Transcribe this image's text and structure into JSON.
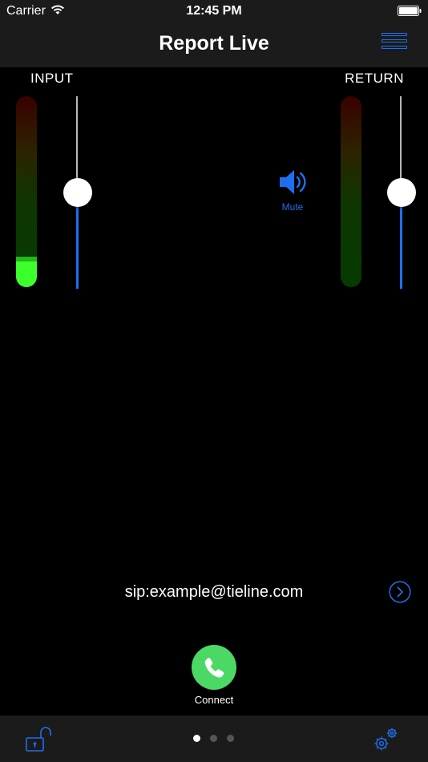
{
  "status_bar": {
    "carrier": "Carrier",
    "time": "12:45 PM"
  },
  "nav": {
    "title": "Report Live"
  },
  "input": {
    "label": "INPUT",
    "meter_level": 0.16,
    "fader_level": 0.5
  },
  "return": {
    "label": "RETURN",
    "meter_level": 0.0,
    "fader_level": 0.5
  },
  "mute": {
    "label": "Mute",
    "icon": "speaker-icon"
  },
  "sip": {
    "address": "sip:example@tieline.com"
  },
  "call": {
    "label": "Connect",
    "icon": "phone-icon"
  },
  "pager": {
    "count": 3,
    "active": 0
  },
  "colors": {
    "accent": "#1e6ff0",
    "call_green": "#4cd864",
    "meter_green": "#3cff2b",
    "bar_bg": "#1b1b1b"
  }
}
